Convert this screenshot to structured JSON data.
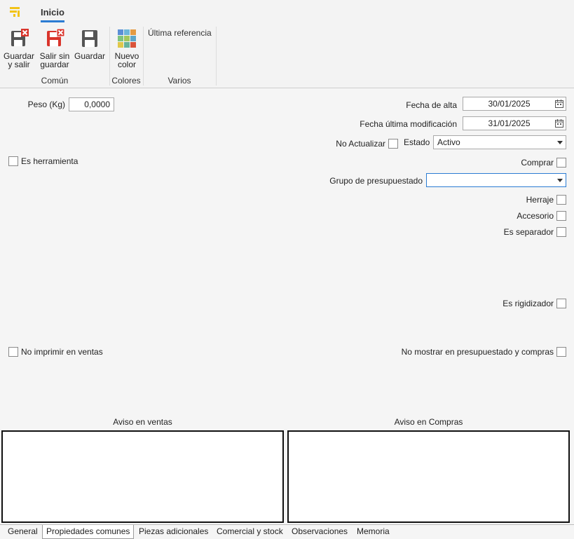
{
  "ribbon": {
    "tab": "Inicio",
    "buttons": {
      "guardar_salir": "Guardar\ny salir",
      "salir_sin_guardar": "Salir sin\nguardar",
      "guardar": "Guardar",
      "nuevo_color": "Nuevo\ncolor"
    },
    "ultima_referencia": "Última referencia",
    "groups": {
      "comun": "Común",
      "colores": "Colores",
      "varios": "Varios"
    }
  },
  "form": {
    "peso_label": "Peso (Kg)",
    "peso_value": "0,0000",
    "fecha_alta_label": "Fecha de alta",
    "fecha_alta_value": "30/01/2025",
    "fecha_mod_label": "Fecha última modificación",
    "fecha_mod_value": "31/01/2025",
    "no_actualizar_label": "No Actualizar",
    "estado_label": "Estado",
    "estado_value": "Activo",
    "es_herramienta_label": "Es herramienta",
    "comprar_label": "Comprar",
    "grupo_label": "Grupo de presupuestado",
    "grupo_value": "",
    "herraje_label": "Herraje",
    "accesorio_label": "Accesorio",
    "es_separador_label": "Es separador",
    "es_rigidizador_label": "Es rigidizador",
    "no_imprimir_label": "No imprimir en ventas",
    "no_mostrar_label": "No mostrar en presupuestado y compras",
    "aviso_ventas_label": "Aviso en ventas",
    "aviso_compras_label": "Aviso en Compras"
  },
  "tabs": [
    "General",
    "Propiedades comunes",
    "Piezas adicionales",
    "Comercial y stock",
    "Observaciones",
    "Memoria"
  ],
  "active_tab": "Propiedades comunes",
  "colors": {
    "accent": "#2b7cd3",
    "logo": "#f2c318",
    "close_red": "#d9342b"
  },
  "icons": [
    "app-logo-icon",
    "save-exit-icon",
    "exit-no-save-icon",
    "save-icon",
    "color-palette-icon",
    "calendar-icon",
    "dropdown-arrow-icon"
  ]
}
